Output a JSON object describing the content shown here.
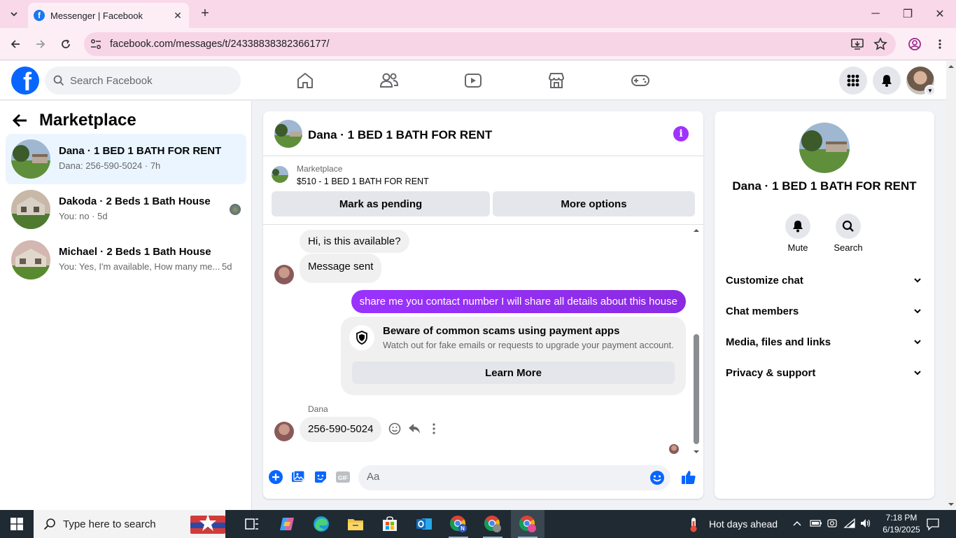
{
  "browser": {
    "tab_title": "Messenger | Facebook",
    "url": "facebook.com/messages/t/24338838382366177/"
  },
  "facebook": {
    "search_placeholder": "Search Facebook"
  },
  "sidebar": {
    "title": "Marketplace",
    "conversations": [
      {
        "name": "Dana · 1 BED 1 BATH FOR RENT",
        "preview": "Dana: 256-590-5024 · 7h",
        "time": ""
      },
      {
        "name": "Dakoda · 2 Beds 1 Bath House",
        "preview": "You: no · 5d",
        "time": ""
      },
      {
        "name": "Michael · 2 Beds 1 Bath House",
        "preview": "You: Yes, I'm available, How many me...",
        "time": "5d"
      }
    ]
  },
  "chat": {
    "header_name": "Dana · 1 BED 1 BATH FOR RENT",
    "listing_label": "Marketplace",
    "listing_price": "$510 - 1 BED 1 BATH FOR RENT",
    "mark_pending": "Mark as pending",
    "more_options": "More options",
    "messages": {
      "m1": "Hi, is this available?",
      "m2": "Message sent",
      "m3": "share me you contact number I will share all details about this house",
      "scam_title": "Beware of common scams using payment apps",
      "scam_body": "Watch out for fake emails or requests to upgrade your payment account.",
      "learn_more": "Learn More",
      "sender": "Dana",
      "m4": "256-590-5024"
    },
    "composer_placeholder": "Aa"
  },
  "info_panel": {
    "name": "Dana · 1 BED 1 BATH FOR RENT",
    "mute": "Mute",
    "search": "Search",
    "sections": [
      "Customize chat",
      "Chat members",
      "Media, files and links",
      "Privacy & support"
    ]
  },
  "taskbar": {
    "search_placeholder": "Type here to search",
    "weather": "Hot days ahead",
    "time": "7:18 PM",
    "date": "6/19/2025"
  },
  "colors": {
    "fb_blue": "#0866ff",
    "accent_purple": "#9a32ff",
    "tab_pink": "#f9d8ea"
  }
}
